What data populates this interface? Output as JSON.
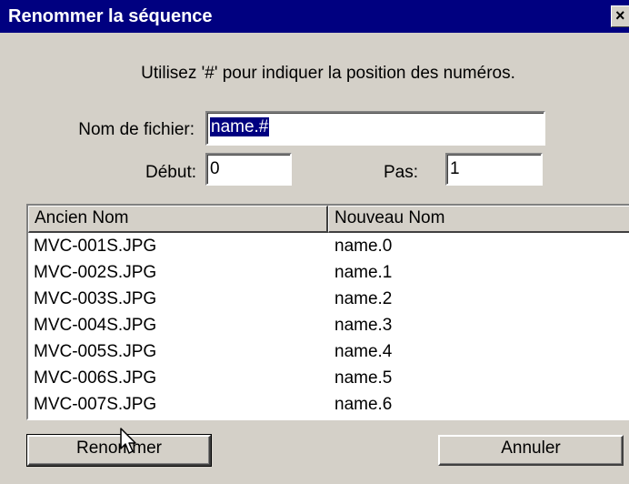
{
  "dialog": {
    "title": "Renommer la séquence",
    "close_glyph": "×"
  },
  "hint": "Utilisez '#' pour indiquer la position des numéros.",
  "fields": {
    "filename_label": "Nom de fichier:",
    "filename_value": "name.#",
    "start_label": "Début:",
    "start_value": "0",
    "step_label": "Pas:",
    "step_value": "1"
  },
  "list": {
    "columns": [
      "Ancien Nom",
      "Nouveau Nom"
    ],
    "rows": [
      {
        "old": "MVC-001S.JPG",
        "new": "name.0"
      },
      {
        "old": "MVC-002S.JPG",
        "new": "name.1"
      },
      {
        "old": "MVC-003S.JPG",
        "new": "name.2"
      },
      {
        "old": "MVC-004S.JPG",
        "new": "name.3"
      },
      {
        "old": "MVC-005S.JPG",
        "new": "name.4"
      },
      {
        "old": "MVC-006S.JPG",
        "new": "name.5"
      },
      {
        "old": "MVC-007S.JPG",
        "new": "name.6"
      }
    ]
  },
  "buttons": {
    "rename_label": "Renommer",
    "cancel_label": "Annuler"
  },
  "icons": {
    "cursor": "mouse-pointer-icon",
    "close": "close-icon"
  },
  "colors": {
    "titlebar": "#000080",
    "face": "#d4d0c8",
    "selection": "#000080"
  }
}
